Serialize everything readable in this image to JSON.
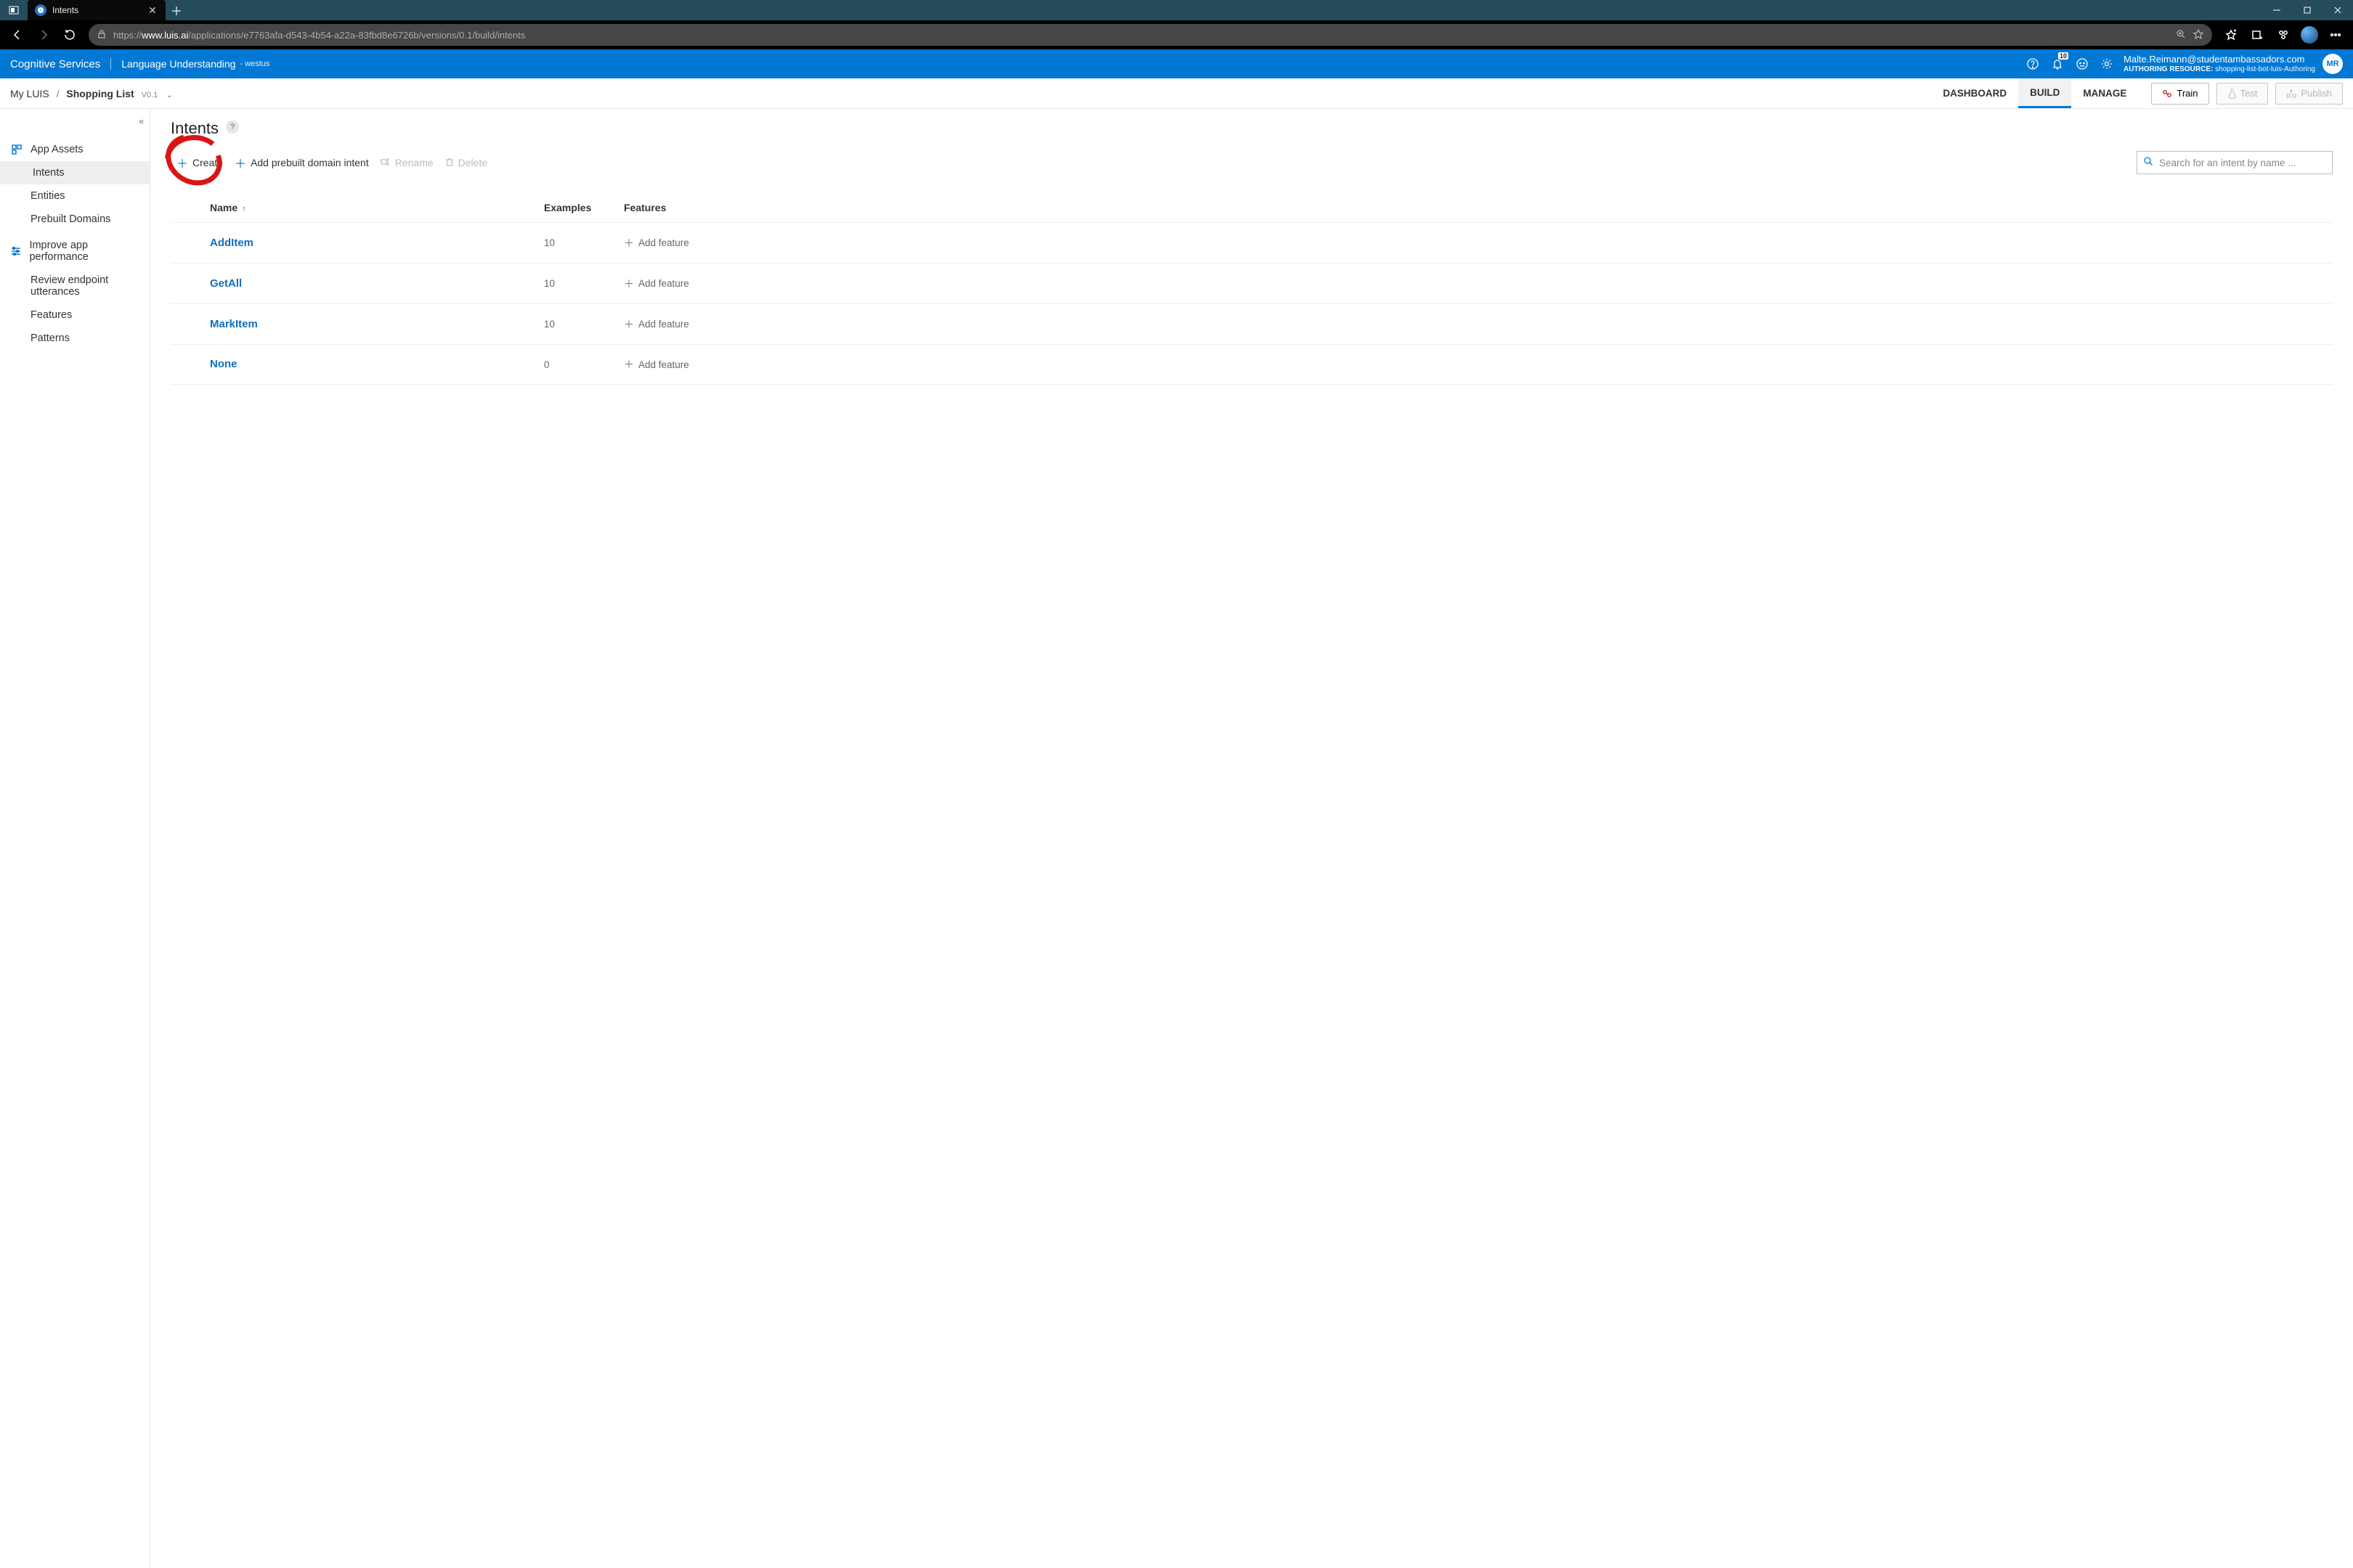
{
  "browser": {
    "tab_title": "Intents",
    "url_prefix": "https://",
    "url_host": "www.luis.ai",
    "url_path": "/applications/e7763afa-d543-4b54-a22a-83fbd8e6726b/versions/0.1/build/intents"
  },
  "blue_header": {
    "title": "Cognitive Services",
    "subtitle": "Language Understanding",
    "location": "- westus",
    "notif_count": "10",
    "user_email": "Malte.Reimann@studentambassadors.com",
    "resource_label": "AUTHORING RESOURCE:",
    "resource_name": "shopping-list-bot-luis-Authoring",
    "avatar": "MR"
  },
  "breadcrumb": {
    "root": "My LUIS",
    "app": "Shopping List",
    "version": "V0.1"
  },
  "subtabs": {
    "dashboard": "DASHBOARD",
    "build": "BUILD",
    "manage": "MANAGE"
  },
  "subbtns": {
    "train": "Train",
    "test": "Test",
    "publish": "Publish"
  },
  "sidebar": {
    "group1": "App Assets",
    "intents": "Intents",
    "entities": "Entities",
    "prebuilt": "Prebuilt Domains",
    "group2": "Improve app performance",
    "review": "Review endpoint utterances",
    "features": "Features",
    "patterns": "Patterns"
  },
  "page": {
    "title": "Intents"
  },
  "cmds": {
    "create": "Create",
    "add_prebuilt": "Add prebuilt domain intent",
    "rename": "Rename",
    "delete": "Delete"
  },
  "search": {
    "placeholder": "Search for an intent by name ..."
  },
  "cols": {
    "name": "Name",
    "examples": "Examples",
    "features": "Features"
  },
  "add_feature": "Add feature",
  "rows": [
    {
      "name": "AddItem",
      "examples": "10"
    },
    {
      "name": "GetAll",
      "examples": "10"
    },
    {
      "name": "MarkItem",
      "examples": "10"
    },
    {
      "name": "None",
      "examples": "0"
    }
  ]
}
